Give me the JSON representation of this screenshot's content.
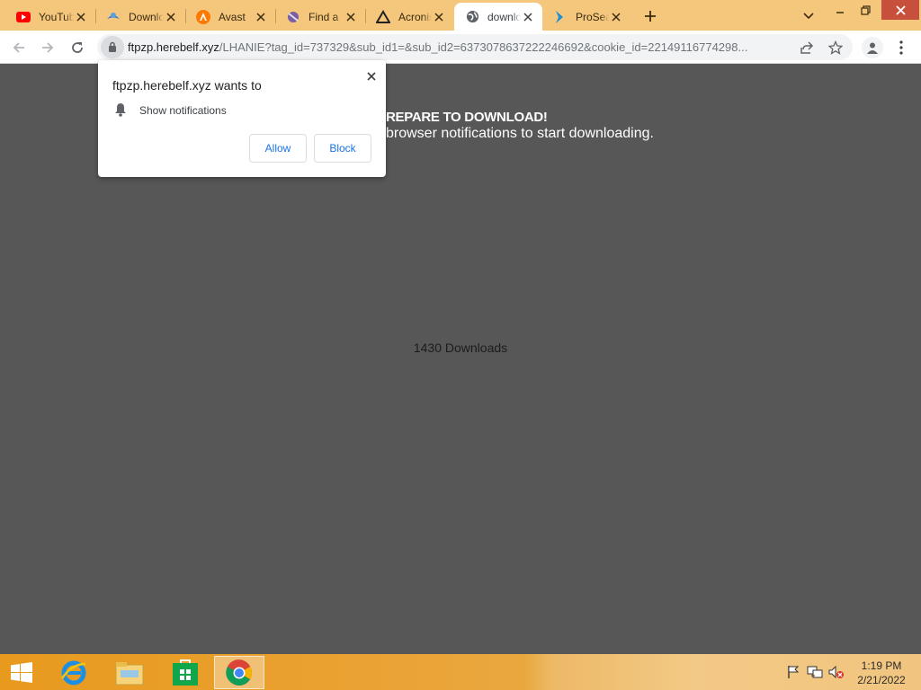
{
  "browser": {
    "tabs": [
      {
        "title": "YouTube",
        "favicon": "youtube-icon"
      },
      {
        "title": "Download",
        "favicon": "download-site-icon"
      },
      {
        "title": "Avast",
        "favicon": "avast-icon"
      },
      {
        "title": "Find a",
        "favicon": "find-site-icon"
      },
      {
        "title": "Acronis",
        "favicon": "acronis-icon"
      },
      {
        "title": "download",
        "favicon": "globe-icon",
        "active": true
      },
      {
        "title": "ProSearch",
        "favicon": "prosearch-icon"
      }
    ],
    "address": {
      "host": "ftpzp.herebelf.xyz",
      "path": "/LHANIE?tag_id=737329&sub_id1=&sub_id2=6373078637222246692&cookie_id=22149116774298..."
    },
    "colors": {
      "tabstrip": "#f4c77d",
      "accent": "#1a73e8",
      "page_bg": "#575757"
    }
  },
  "page": {
    "headline": "REPARE TO DOWNLOAD!",
    "subline": "browser notifications to start downloading.",
    "downloads": "1430 Downloads"
  },
  "permission_popup": {
    "title": "ftpzp.herebelf.xyz wants to",
    "permission": "Show notifications",
    "allow_label": "Allow",
    "block_label": "Block"
  },
  "taskbar": {
    "apps": [
      "start-button",
      "internet-explorer-icon",
      "file-explorer-icon",
      "windows-store-icon",
      "chrome-icon"
    ],
    "clock": {
      "time": "1:19 PM",
      "date": "2/21/2022"
    }
  }
}
